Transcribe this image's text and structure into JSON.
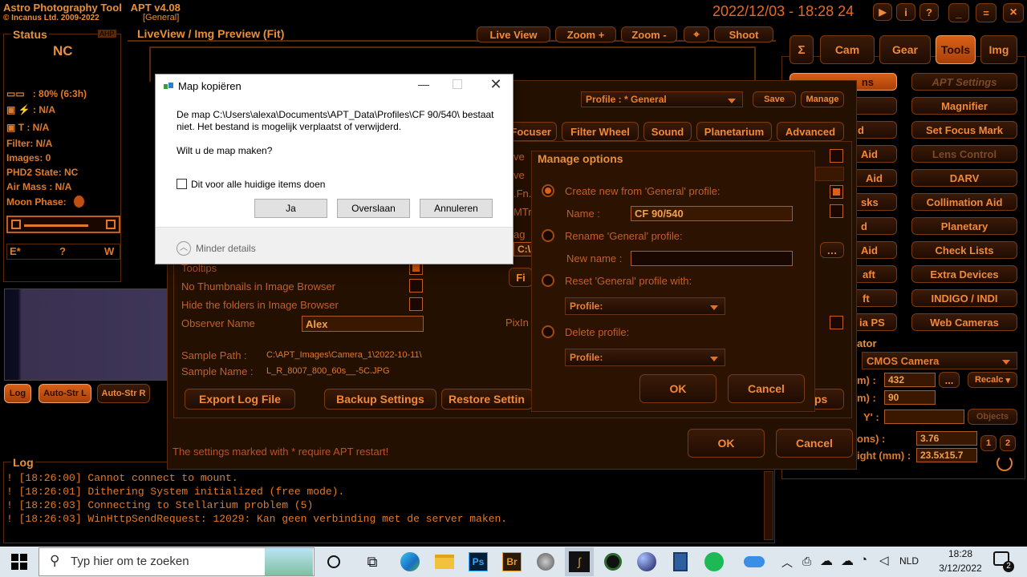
{
  "app": {
    "title": "Astro Photography Tool",
    "version": "APT v4.08",
    "copyright": "© Incanus Ltd. 2009-2022",
    "profile": "[General]",
    "datetime": "2022/12/03 - 18:28 24"
  },
  "window_buttons": {
    "play": "▶",
    "info": "i",
    "help": "?",
    "min": "_",
    "max": "=",
    "close": "×"
  },
  "status": {
    "title": "Status",
    "ahp": "AHP",
    "nc": "NC",
    "battery": ": 80% (6:3h)",
    "power": "N/A",
    "temp": "T : N/A",
    "filter": "Filter: N/A",
    "images": "Images: 0",
    "phd2": "PHD2 State: NC",
    "airmass": "Air Mass : N/A",
    "moon": "Moon Phase:",
    "e": "E*",
    "q": "?",
    "w": "W"
  },
  "liveview": {
    "title": "LiveView / Img Preview (Fit)",
    "live": "Live View",
    "zoom_in": "Zoom +",
    "zoom_out": "Zoom -",
    "shoot": "Shoot"
  },
  "log": {
    "title": "Log",
    "lines": [
      "! [18:26:00] Cannot connect to mount.",
      "! [18:26:01] Dithering System initialized (free mode).",
      "! [18:26:03] Connecting to Stellarium problem (5)",
      "! [18:26:03] WinHttpSendRequest: 12029: Kan geen verbinding met de server maken."
    ]
  },
  "log_buttons": {
    "log": "Log",
    "auto_l": "Auto-Str L",
    "auto_r": "Auto-Str R"
  },
  "main_tabs": {
    "sigma": "Σ",
    "cam": "Cam",
    "gear": "Gear",
    "tools": "Tools",
    "img": "Img"
  },
  "tools": {
    "apt_settings": "APT Settings",
    "magnifier": "Magnifier",
    "focus_mark": "Set Focus Mark",
    "lens": "Lens Control",
    "darv": "DARV",
    "collimation": "Collimation Aid",
    "planetary": "Planetary",
    "checklists": "Check Lists",
    "extra": "Extra Devices",
    "indigo": "INDIGO / INDI",
    "webcams": "Web Cameras"
  },
  "left_tools": {
    "t1": "ns",
    "t2": "d",
    "t3": "Aid",
    "t4": "Aid",
    "t5": "sks",
    "t6": "d",
    "t7": "Aid",
    "t8": "aft",
    "t9": "ft",
    "t10": "ia PS",
    "calc": "ator",
    "camera": "CMOS Camera",
    "r1": "m) :",
    "v1": "432",
    "r2": "m) :",
    "v2": "90",
    "r3": "Y' :",
    "objects": "Objects",
    "recalc": "Recalc",
    "r4": "ons) :",
    "v4": "3.76",
    "r5": "ight (mm) :",
    "v5": "23.5x15.7",
    "b1": "1",
    "b2": "2",
    "more": "..."
  },
  "settings": {
    "profile": "Profile : * General",
    "save": "Save",
    "manage": "Manage",
    "tab_focuser": "Focuser",
    "tab_filter": "Filter Wheel",
    "tab_sound": "Sound",
    "tab_planetarium": "Planetarium",
    "tab_advanced": "Advanced",
    "tooltips": "Tooltips",
    "no_thumbs": "No Thumbnails in Image Browser",
    "hide_folders": "Hide the folders in Image Browser",
    "observer_label": "Observer Name",
    "observer": "Alex",
    "sample_path_label": "Sample Path :",
    "sample_path": "C:\\APT_Images\\Camera_1\\2022-10-11\\",
    "sample_name_label": "Sample Name :",
    "sample_name": "L_R_8007_800_60s__-5C.JPG",
    "export_log": "Export Log File",
    "backup": "Backup Settings",
    "restore": "Restore Settin",
    "ps": "ps",
    "restart_note": "The settings marked with * require APT restart!",
    "ok": "OK",
    "cancel": "Cancel",
    "frag1": "ve",
    "frag2": "ve",
    "frag3": ".Fn.",
    "frag4": "MTr",
    "frag5": "ag",
    "frag6": "C:\\A",
    "frag7": "Fi",
    "frag8": "PixIn"
  },
  "manage": {
    "title": "Manage options",
    "create": "Create new from 'General' profile:",
    "name_label": "Name :",
    "name": "CF 90/540",
    "rename": "Rename 'General' profile:",
    "new_name_label": "New name :",
    "new_name": "",
    "reset": "Reset 'General' profile with:",
    "profile1": "Profile:",
    "delete": "Delete profile:",
    "profile2": "Profile:",
    "ok": "OK",
    "cancel": "Cancel"
  },
  "dialog": {
    "title": "Map kopiëren",
    "message1": "De map C:\\Users\\alexa\\Documents\\APT_Data\\Profiles\\CF 90/540\\ bestaat",
    "message2": "niet. Het bestand is mogelijk verplaatst of verwijderd.",
    "question": "Wilt u de map maken?",
    "checkbox": "Dit voor alle huidige items doen",
    "yes": "Ja",
    "skip": "Overslaan",
    "cancel": "Annuleren",
    "less": "Minder details"
  },
  "taskbar": {
    "search": "Typ hier om te zoeken",
    "lang": "NLD",
    "time": "18:28",
    "date": "3/12/2022",
    "notif": "2",
    "ps": "Ps",
    "br": "Br"
  },
  "colors": {
    "accent": "#e07a2a",
    "hot": "#d86018",
    "win_blue": "#0078d7"
  }
}
